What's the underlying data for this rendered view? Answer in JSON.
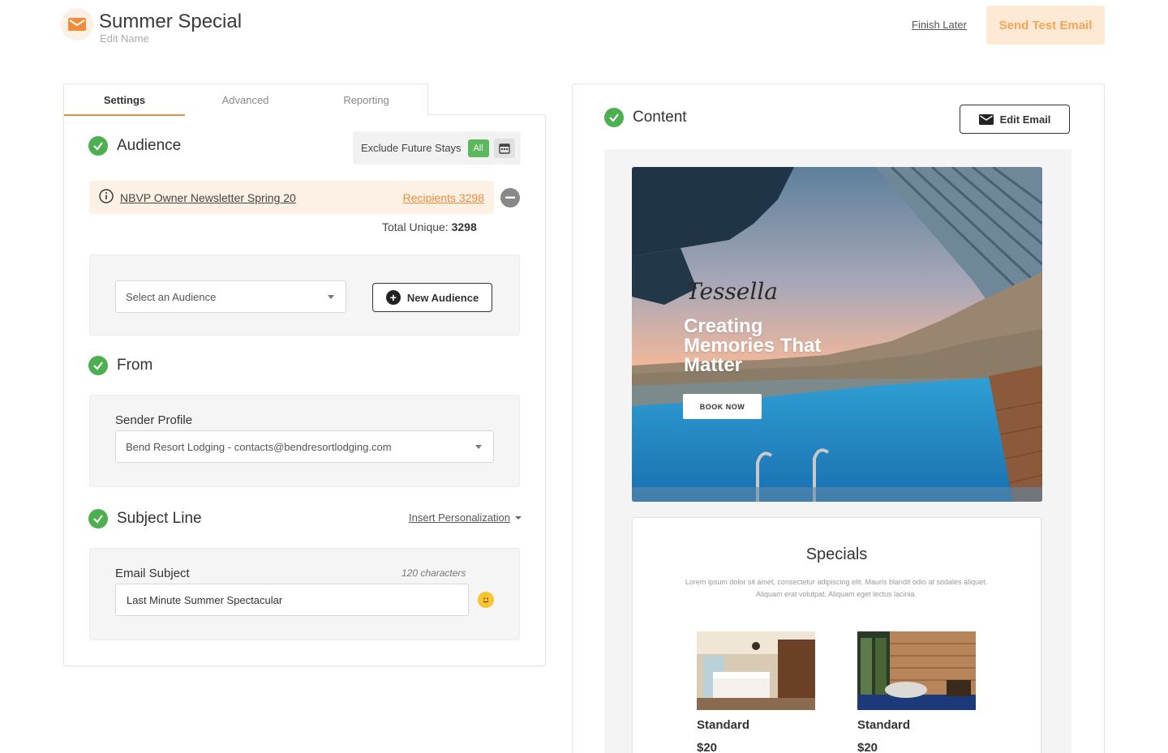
{
  "header": {
    "title": "Summer Special",
    "edit_name": "Edit Name",
    "finish_later": "Finish Later",
    "send_test": "Send Test Email",
    "accent_color": "#f08c3a"
  },
  "tabs": [
    {
      "label": "Settings",
      "active": true
    },
    {
      "label": "Advanced",
      "active": false
    },
    {
      "label": "Reporting",
      "active": false
    }
  ],
  "audience": {
    "heading": "Audience",
    "exclude_label": "Exclude Future Stays",
    "exclude_badge": "All",
    "list_name": "NBVP Owner Newsletter Spring 20",
    "recipients": "Recipients 3298",
    "total_label": "Total Unique:",
    "total_value": "3298",
    "select_placeholder": "Select an Audience",
    "new_button": "New Audience"
  },
  "from": {
    "heading": "From",
    "sender_label": "Sender Profile",
    "sender_value": "Bend Resort Lodging - contacts@bendresortlodging.com"
  },
  "subject": {
    "heading": "Subject Line",
    "insert_personalization": "Insert Personalization",
    "field_label": "Email Subject",
    "char_count": "120 characters",
    "value": "Last Minute Summer Spectacular"
  },
  "content": {
    "heading": "Content",
    "edit_button": "Edit Email",
    "hero_brand": "Tessella",
    "hero_headline": "Creating Memories That Matter",
    "book_button": "BOOK NOW",
    "specials_title": "Specials",
    "specials_desc": "Lorem ipsum dolor sit amet, consectetur adipiscing elit. Mauris blandit odio at sodales aliquet. Aliquam erat volutpat. Aliquam eget lectus lacinia.",
    "rooms": [
      {
        "name": "Standard",
        "price": "$20"
      },
      {
        "name": "Standard",
        "price": "$20"
      }
    ]
  }
}
